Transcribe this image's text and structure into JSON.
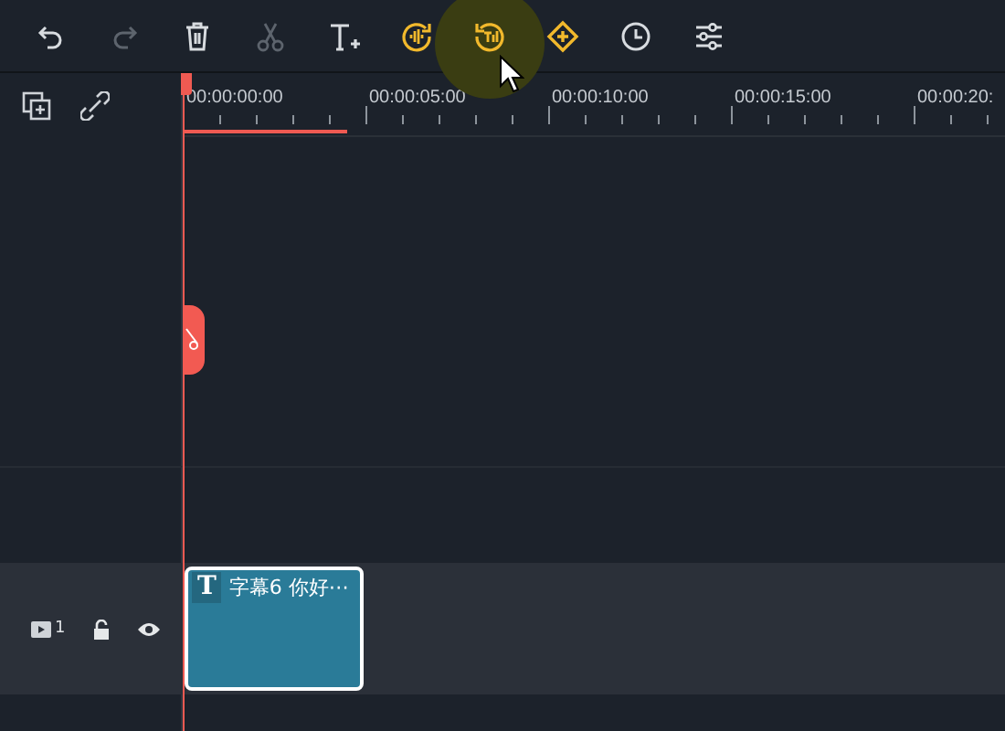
{
  "toolbar": [
    {
      "kind": "undo",
      "disabled": false,
      "highlighted": false,
      "hovered": false
    },
    {
      "kind": "redo",
      "disabled": true,
      "highlighted": false,
      "hovered": false
    },
    {
      "kind": "delete",
      "disabled": false,
      "highlighted": false,
      "hovered": false
    },
    {
      "kind": "cut",
      "disabled": true,
      "highlighted": false,
      "hovered": false
    },
    {
      "kind": "add-text",
      "disabled": false,
      "highlighted": false,
      "hovered": false
    },
    {
      "kind": "audio",
      "disabled": false,
      "highlighted": true,
      "hovered": false
    },
    {
      "kind": "speech",
      "disabled": false,
      "highlighted": true,
      "hovered": true
    },
    {
      "kind": "keyframe",
      "disabled": false,
      "highlighted": true,
      "hovered": false
    },
    {
      "kind": "clock",
      "disabled": false,
      "highlighted": false,
      "hovered": false
    },
    {
      "kind": "adjust",
      "disabled": false,
      "highlighted": false,
      "hovered": false
    }
  ],
  "ruler": {
    "labels": [
      "00:00:00:00",
      "00:00:05:00",
      "00:00:10:00",
      "00:00:15:00",
      "00:00:20:"
    ],
    "level": 0.2
  },
  "track": {
    "number": "1",
    "clip": {
      "icon": "T",
      "title": "字幕6 你好⋯",
      "selected": true
    }
  }
}
